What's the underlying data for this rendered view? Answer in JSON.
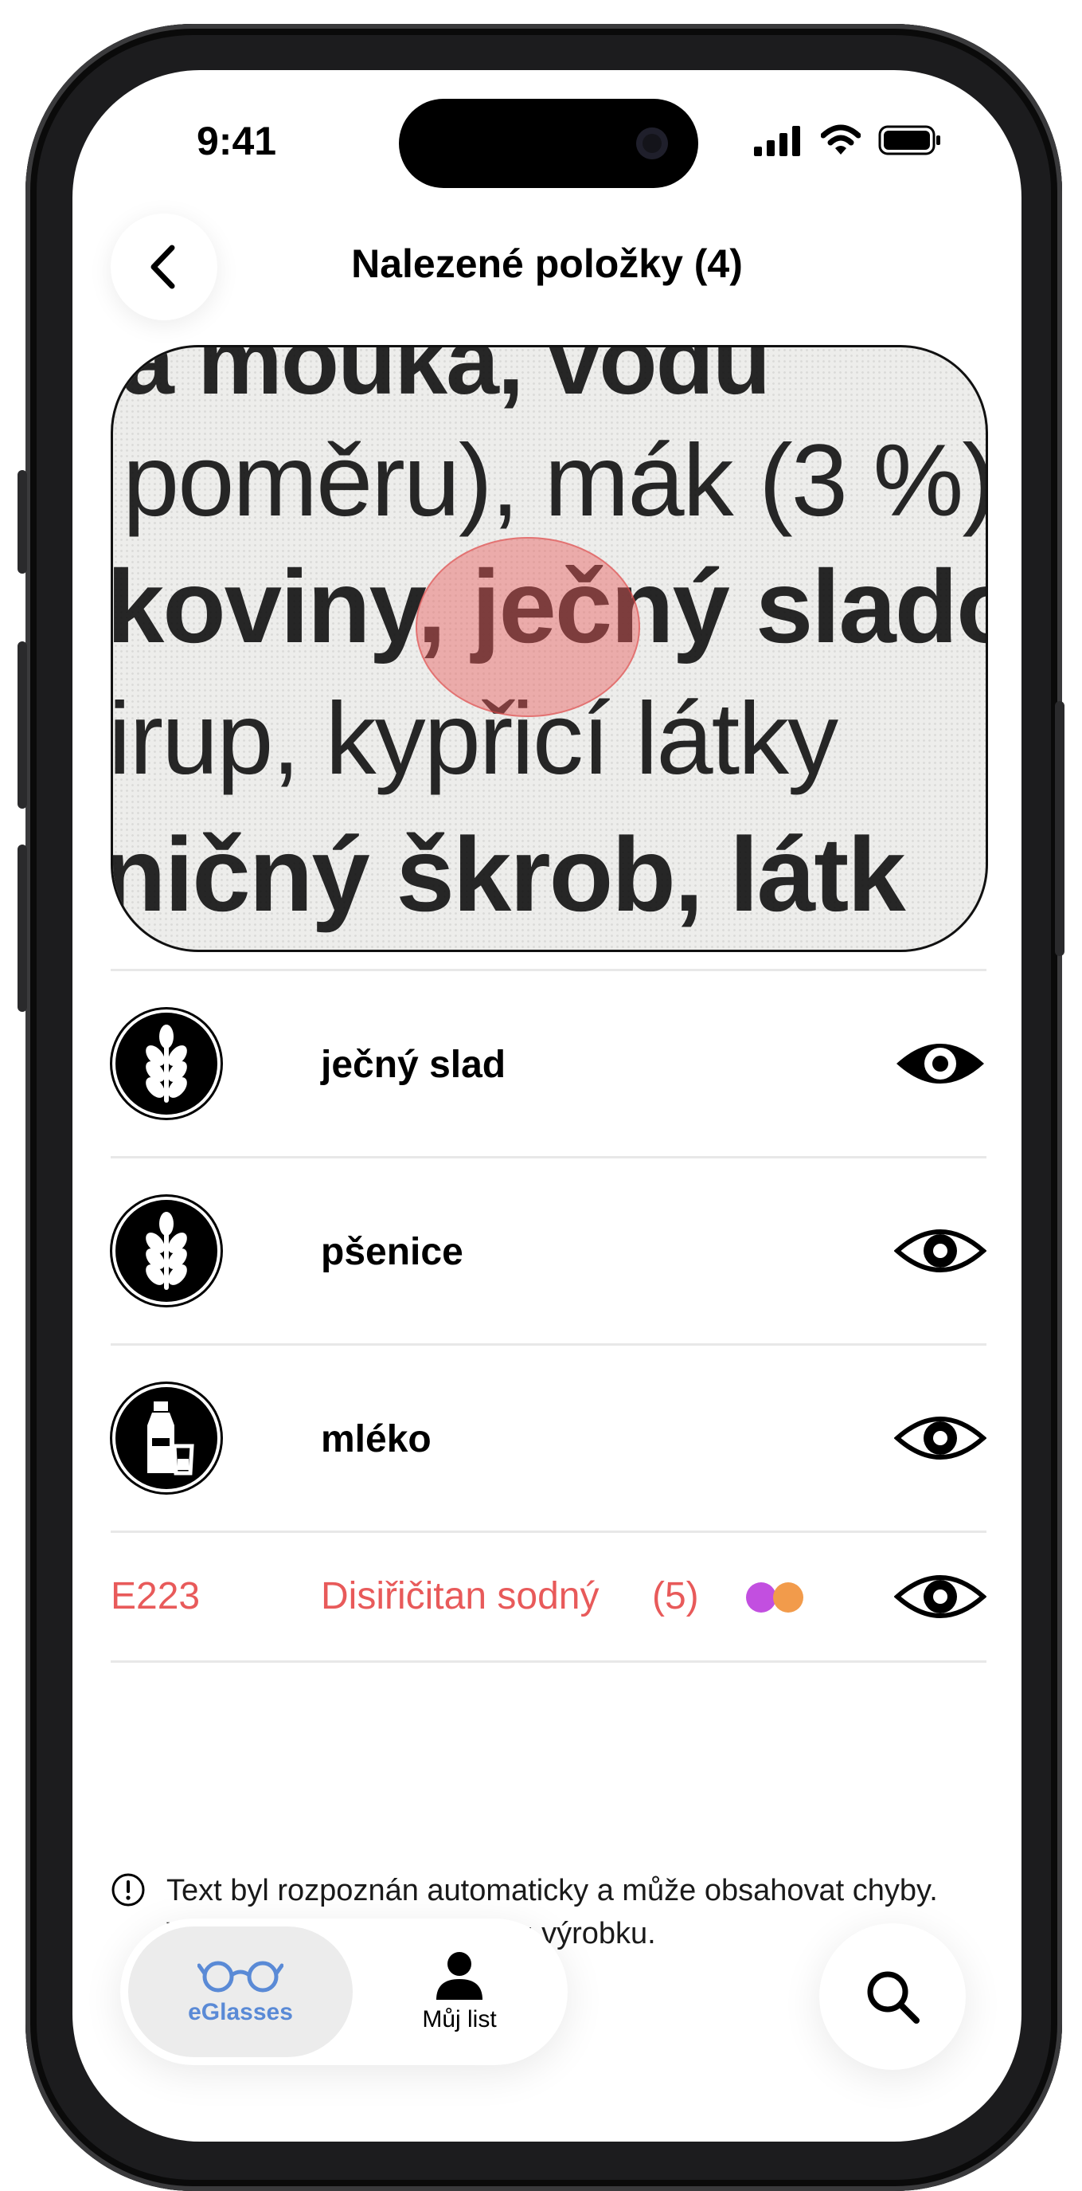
{
  "status_bar": {
    "time": "9:41"
  },
  "header": {
    "title": "Nalezené položky (4)",
    "back_icon": "chevron-left-icon"
  },
  "photo": {
    "lines": [
      "a mouka, vodu",
      "poměru), mák (3 %)",
      "koviny, ječný sladový",
      "irup,  kypřicí  látky",
      "ničný  škrob,  látk"
    ],
    "highlight_color": "#e85a5a"
  },
  "items": [
    {
      "label": "ječný slad",
      "icon": "wheat-icon"
    },
    {
      "label": "pšenice",
      "icon": "wheat-icon"
    },
    {
      "label": "mléko",
      "icon": "milk-bottle-icon"
    }
  ],
  "additive": {
    "code": "E223",
    "name": "Disiřičitan sodný",
    "count": "(5)",
    "dot_colors": [
      "#c24fe0",
      "#f29b4b"
    ],
    "color": "#e85a5a"
  },
  "disclaimer": {
    "icon": "info-circle-icon",
    "text": "Text byl rozpoznán automaticky a může obsahovat chyby. Vždy ověřte údaje na obalu výrobku."
  },
  "tabbar": {
    "tabs": [
      {
        "label": "eGlasses",
        "icon": "glasses-icon",
        "active": true
      },
      {
        "label": "Můj list",
        "icon": "person-icon",
        "active": false
      }
    ],
    "accent": "#5a8ad6"
  },
  "search": {
    "icon": "search-icon"
  }
}
